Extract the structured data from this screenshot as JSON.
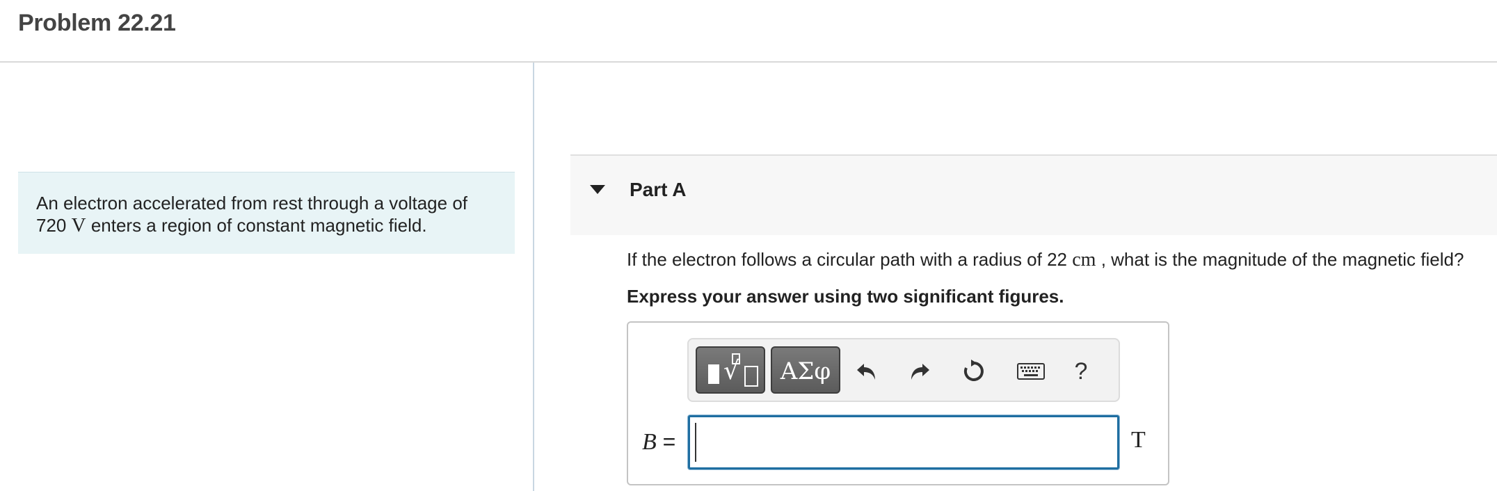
{
  "header": {
    "title": "Problem 22.21"
  },
  "intro": {
    "line1": "An electron accelerated from rest through a voltage of",
    "voltage_value": "720",
    "voltage_unit": "V",
    "line2_rest": "enters a region of constant magnetic field."
  },
  "part": {
    "title": "Part A",
    "expanded": true
  },
  "question": {
    "prefix": "If the electron follows a circular path with a radius of 22",
    "unit": "cm",
    "suffix": ", what is the magnitude of the magnetic field?"
  },
  "instruction": "Express your answer using two significant figures.",
  "toolbar": {
    "templates_icon": "templates-radical-icon",
    "greek_label": "ΑΣφ",
    "undo_icon": "undo-icon",
    "redo_icon": "redo-icon",
    "reset_icon": "reset-icon",
    "keyboard_icon": "keyboard-icon",
    "help_label": "?"
  },
  "answer": {
    "variable": "B",
    "equals": "=",
    "value": "",
    "unit": "T"
  },
  "colors": {
    "intro_bg": "#e8f4f6",
    "input_border": "#1f6ea1",
    "toolbar_button": "#6a6a6a"
  }
}
